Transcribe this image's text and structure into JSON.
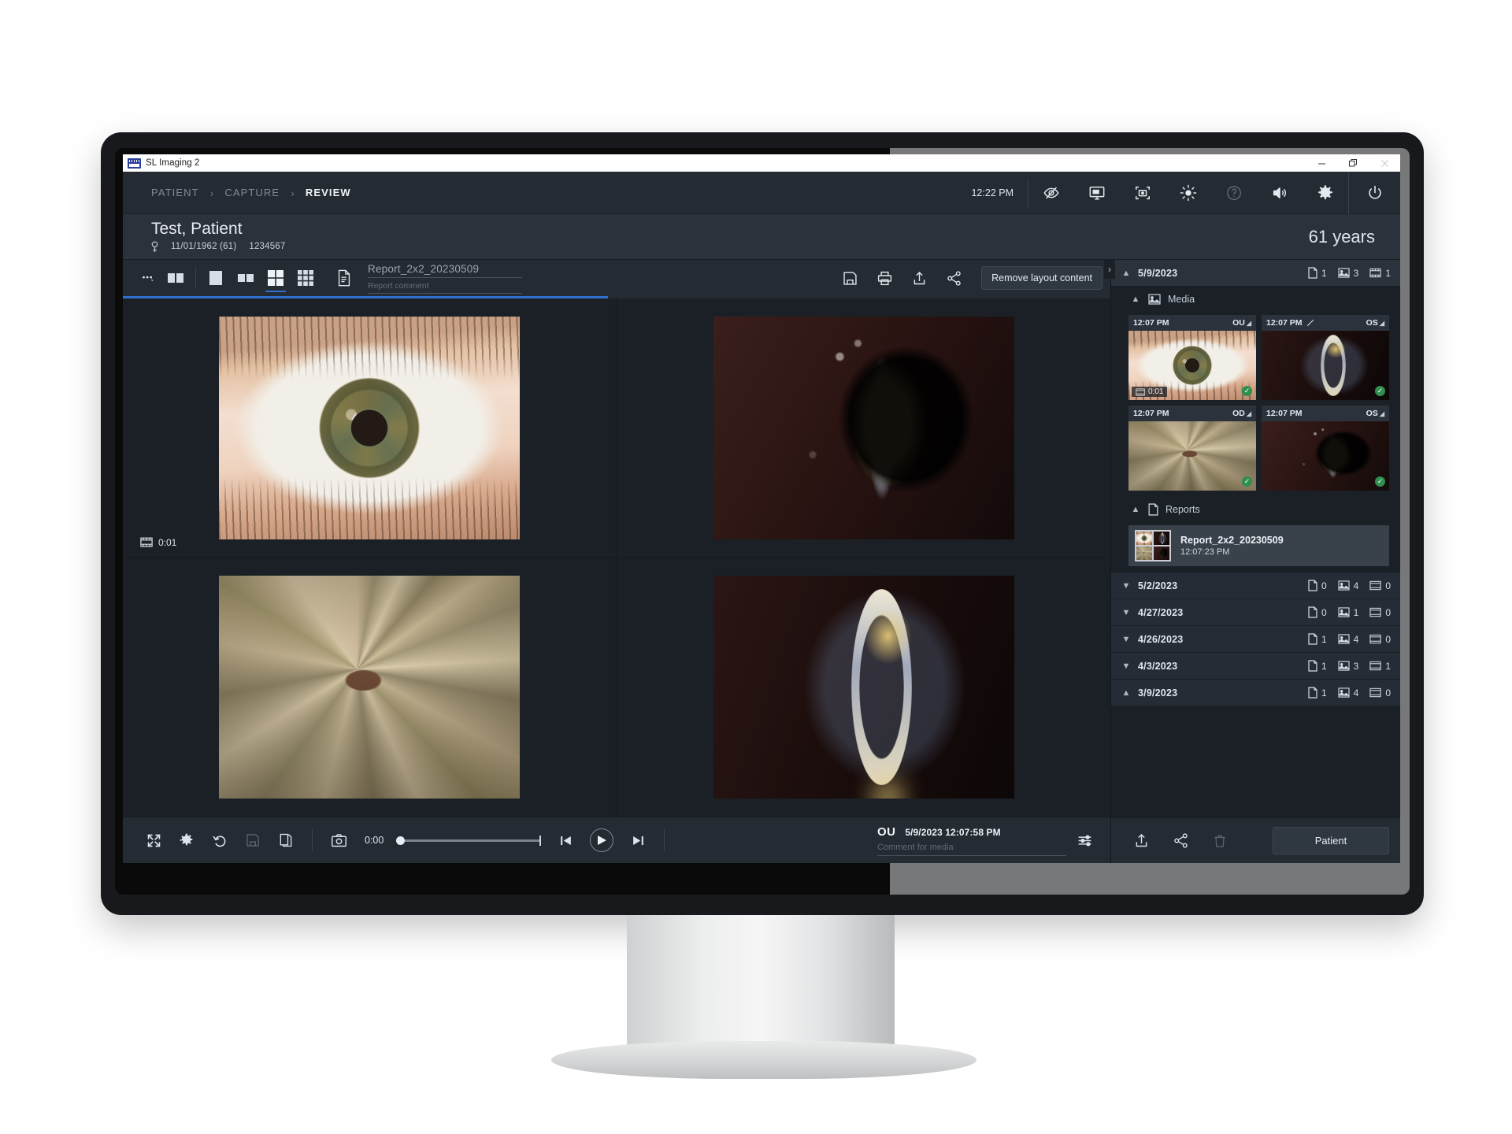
{
  "window": {
    "title": "SL Imaging 2",
    "minimize": "–",
    "maximize": "❐",
    "close": "✕"
  },
  "header": {
    "breadcrumbs": [
      {
        "label": "PATIENT",
        "active": false
      },
      {
        "label": "CAPTURE",
        "active": false
      },
      {
        "label": "REVIEW",
        "active": true
      }
    ],
    "separator": "›",
    "time": "12:22 PM",
    "tools": [
      "eye-off-icon",
      "monitor-presentation-icon",
      "capture-region-icon",
      "brightness-icon",
      "help-icon",
      "volume-icon",
      "settings-gear-icon",
      "power-icon"
    ]
  },
  "patient": {
    "name": "Test, Patient",
    "sex_icon": "female-symbol",
    "dob": "11/01/1962 (61)",
    "id": "1234567",
    "age": "61 years"
  },
  "viewer_toolbar": {
    "more_label": "•••",
    "layouts": [
      {
        "name": "layout-1x2-wide",
        "selected": false
      },
      {
        "name": "layout-1x1",
        "selected": false
      },
      {
        "name": "layout-1x2",
        "selected": false
      },
      {
        "name": "layout-2x2",
        "selected": true
      },
      {
        "name": "layout-3x3",
        "selected": false
      }
    ],
    "report_icon": "report-document-icon",
    "report_name": "Report_2x2_20230509",
    "report_comment_placeholder": "Report comment",
    "actions": [
      "save-icon",
      "print-icon",
      "export-icon",
      "share-icon"
    ],
    "remove_layout_label": "Remove layout content"
  },
  "grid": {
    "cells": [
      {
        "name": "cell-anterior-eye",
        "kind": "eye-anterior",
        "badge": "0:01",
        "badge_icon": "film-icon"
      },
      {
        "name": "cell-slit-lamp-od",
        "kind": "slit-dark",
        "badge": "",
        "badge_icon": ""
      },
      {
        "name": "cell-iris-macro",
        "kind": "iris-macro",
        "badge": "",
        "badge_icon": ""
      },
      {
        "name": "cell-slit-beam-os",
        "kind": "slit-beam",
        "badge": "",
        "badge_icon": ""
      }
    ]
  },
  "viewer_bottom": {
    "tools": [
      "fullscreen-icon",
      "adjust-gear-icon",
      "rotate-left-icon",
      "save-icon",
      "copy-icon"
    ],
    "camera_icon": "camera-icon",
    "current_time": "0:00",
    "transport": [
      "skip-previous-icon",
      "play-icon",
      "skip-next-icon"
    ],
    "media": {
      "eye": "OU",
      "datetime": "5/9/2023  12:07:58 PM",
      "comment_placeholder": "Comment for media"
    },
    "equalizer_icon": "levels-icon"
  },
  "sidebar": {
    "collapse_handle_icon": "chevron-right-icon",
    "sessions": [
      {
        "date": "5/9/2023",
        "expanded": true,
        "counts": {
          "reports": "1",
          "images": "3",
          "videos": "1"
        },
        "sections": [
          {
            "title": "Media",
            "icon": "image-icon",
            "expanded": true,
            "thumbnails": [
              {
                "time": "12:07 PM",
                "eye": "OU",
                "edited": false,
                "badge": "0:01",
                "checked": true,
                "kind": "eye-anterior"
              },
              {
                "time": "12:07 PM",
                "eye": "OS",
                "edited": true,
                "badge": "",
                "checked": true,
                "kind": "slit-beam"
              },
              {
                "time": "12:07 PM",
                "eye": "OD",
                "edited": false,
                "badge": "",
                "checked": true,
                "kind": "iris-macro"
              },
              {
                "time": "12:07 PM",
                "eye": "OS",
                "edited": false,
                "badge": "",
                "checked": true,
                "kind": "slit-dark"
              }
            ]
          },
          {
            "title": "Reports",
            "icon": "report-document-icon",
            "expanded": true,
            "items": [
              {
                "name": "Report_2x2_20230509",
                "time": "12:07:23 PM",
                "selected": true
              }
            ]
          }
        ]
      },
      {
        "date": "5/2/2023",
        "expanded": false,
        "counts": {
          "reports": "0",
          "images": "4",
          "videos": "0"
        }
      },
      {
        "date": "4/27/2023",
        "expanded": false,
        "counts": {
          "reports": "0",
          "images": "1",
          "videos": "0"
        }
      },
      {
        "date": "4/26/2023",
        "expanded": false,
        "counts": {
          "reports": "1",
          "images": "4",
          "videos": "0"
        }
      },
      {
        "date": "4/3/2023",
        "expanded": false,
        "counts": {
          "reports": "1",
          "images": "3",
          "videos": "1"
        }
      },
      {
        "date": "3/9/2023",
        "expanded": false,
        "counts": {
          "reports": "1",
          "images": "4",
          "videos": "0"
        }
      }
    ],
    "footer": {
      "tools": [
        "export-icon",
        "share-icon",
        "delete-icon"
      ],
      "patient_label": "Patient"
    }
  },
  "colors": {
    "accent": "#2f6fd0",
    "panel": "#252b33",
    "background": "#1b2027",
    "row": "#2b323b",
    "check_green": "#2f8f4e",
    "text": "#e4e9ef",
    "muted": "#7e8a99"
  }
}
